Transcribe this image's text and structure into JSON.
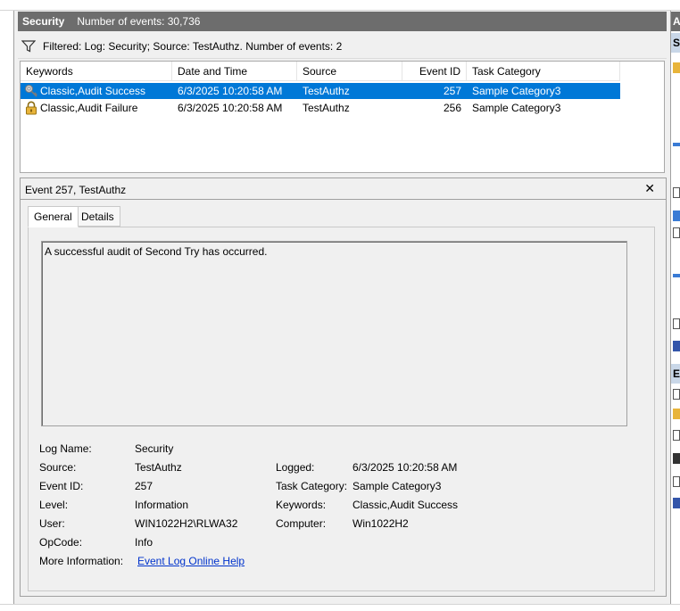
{
  "header": {
    "title": "Security",
    "count_text": "Number of events: 30,736"
  },
  "filter": {
    "text": "Filtered: Log: Security; Source: TestAuthz. Number of events: 2"
  },
  "list": {
    "columns": [
      "Keywords",
      "Date and Time",
      "Source",
      "Event ID",
      "Task Category"
    ],
    "rows": [
      {
        "keywords": "Classic,Audit Success",
        "datetime": "6/3/2025 10:20:58 AM",
        "source": "TestAuthz",
        "event_id": "257",
        "task_category": "Sample Category3",
        "icon": "key-icon",
        "selected": true
      },
      {
        "keywords": "Classic,Audit Failure",
        "datetime": "6/3/2025 10:20:58 AM",
        "source": "TestAuthz",
        "event_id": "256",
        "task_category": "Sample Category3",
        "icon": "lock-icon",
        "selected": false
      }
    ]
  },
  "detail": {
    "title": "Event 257, TestAuthz",
    "close": "✕",
    "tabs": [
      "General",
      "Details"
    ],
    "description": "A successful audit of Second Try has occurred.",
    "props": {
      "log_name_label": "Log Name:",
      "log_name": "Security",
      "source_label": "Source:",
      "source": "TestAuthz",
      "logged_label": "Logged:",
      "logged": "6/3/2025 10:20:58 AM",
      "event_id_label": "Event ID:",
      "event_id": "257",
      "task_category_label": "Task Category:",
      "task_category": "Sample Category3",
      "level_label": "Level:",
      "level": "Information",
      "keywords_label": "Keywords:",
      "keywords": "Classic,Audit Success",
      "user_label": "User:",
      "user": "WIN1022H2\\RLWA32",
      "computer_label": "Computer:",
      "computer": "Win1022H2",
      "opcode_label": "OpCode:",
      "opcode": "Info",
      "more_info_label": "More Information:",
      "more_info_link": "Event Log Online Help"
    }
  },
  "right_panel": {
    "head_letter": "A",
    "sub_letter_1": "S",
    "sub_letter_2": "E"
  },
  "colors": {
    "header_bg": "#6d6d6d",
    "selection": "#0078d7",
    "link": "#0033cc"
  }
}
